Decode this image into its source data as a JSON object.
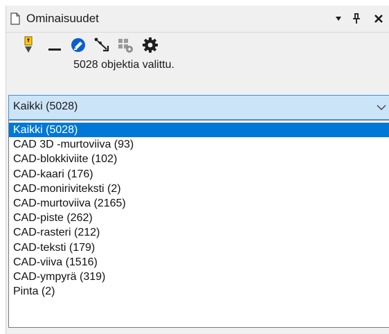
{
  "window": {
    "title": "Ominaisuudet",
    "doc_icon": "document-icon",
    "dropdown_icon": "triangle-down-icon",
    "pin_icon": "pin-icon",
    "close_icon": "close-icon"
  },
  "toolbar": {
    "tools": [
      "highlight-selection-icon",
      "minimize-line-icon",
      "edit-eraser-icon",
      "pick-arrow-icon",
      "query-grid-icon",
      "settings-gear-icon"
    ]
  },
  "selection": {
    "summary": "5028 objektia valittu."
  },
  "filter": {
    "selected": "Kaikki (5028)",
    "options": [
      "Kaikki (5028)",
      "CAD 3D -murtoviiva (93)",
      "CAD-blokkiviite (102)",
      "CAD-kaari (176)",
      "CAD-monirivi­teksti (2)",
      "CAD-murtoviiva (2165)",
      "CAD-piste (262)",
      "CAD-rasteri (212)",
      "CAD-teksti (179)",
      "CAD-viiva (1516)",
      "CAD-ympyrä (319)",
      "Pinta (2)"
    ]
  },
  "colors": {
    "accent": "#0078d7",
    "combo_bg": "#cce4f7",
    "gear": "#1f1f1f",
    "eraser": "#0a5fd0",
    "highlight": "#f0c000"
  }
}
